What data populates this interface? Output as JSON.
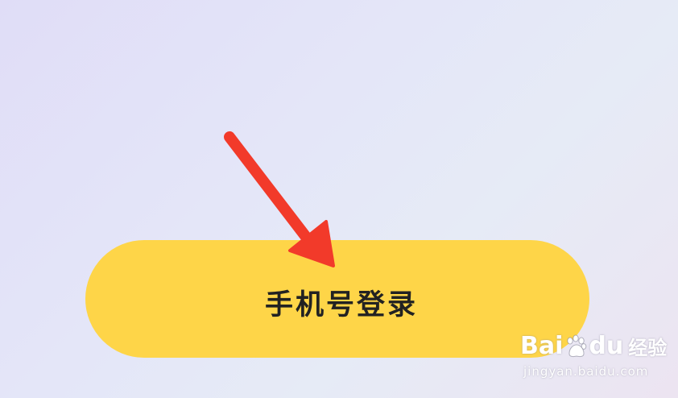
{
  "login": {
    "phone_login_label": "手机号登录"
  },
  "watermark": {
    "brand_prefix": "Bai",
    "brand_suffix": "du",
    "brand_product": "经验",
    "url": "jingyan.baidu.com"
  },
  "colors": {
    "button_fill": "#fed548",
    "arrow": "#f23a2a",
    "label_text": "#222222"
  },
  "icons": {
    "pointer": "red-arrow-icon",
    "paw": "baidu-paw-icon"
  }
}
